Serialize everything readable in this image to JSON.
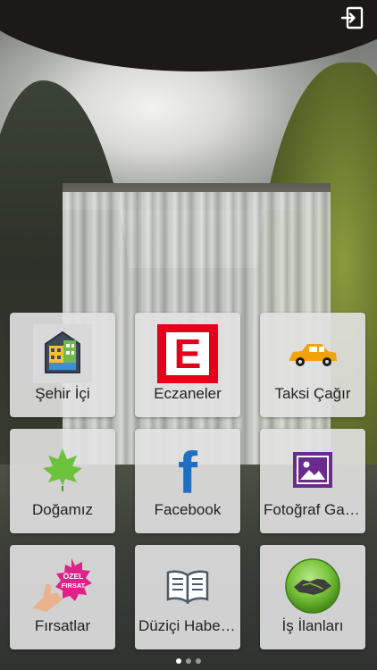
{
  "header": {
    "logout_icon": "logout-icon"
  },
  "tiles": [
    {
      "label": "Şehir İçi",
      "icon": "city-buildings-icon"
    },
    {
      "label": "Eczaneler",
      "icon": "pharmacy-e-icon",
      "icon_letter": "E",
      "accent": "#e4001b"
    },
    {
      "label": "Taksi Çağır",
      "icon": "taxi-car-icon",
      "accent": "#f2a20a"
    },
    {
      "label": "Doğamız",
      "icon": "leaf-icon",
      "accent": "#6cc23a"
    },
    {
      "label": "Facebook",
      "icon": "facebook-icon",
      "icon_letter": "f",
      "accent": "#1f6fc1"
    },
    {
      "label": "Fotoğraf Galerisi",
      "icon": "photo-gallery-icon",
      "accent": "#6b2a8e"
    },
    {
      "label": "Fırsatlar",
      "icon": "special-offer-icon",
      "badge_top": "ÖZEL",
      "badge_bottom": "FIRSAT",
      "accent": "#e0218a"
    },
    {
      "label": "Düziçi Haberleri",
      "icon": "open-book-icon",
      "accent": "#4a5a6a"
    },
    {
      "label": "İş İlanları",
      "icon": "handshake-icon",
      "accent": "#7ac43a"
    }
  ],
  "pager": {
    "pages": 3,
    "active": 1
  }
}
